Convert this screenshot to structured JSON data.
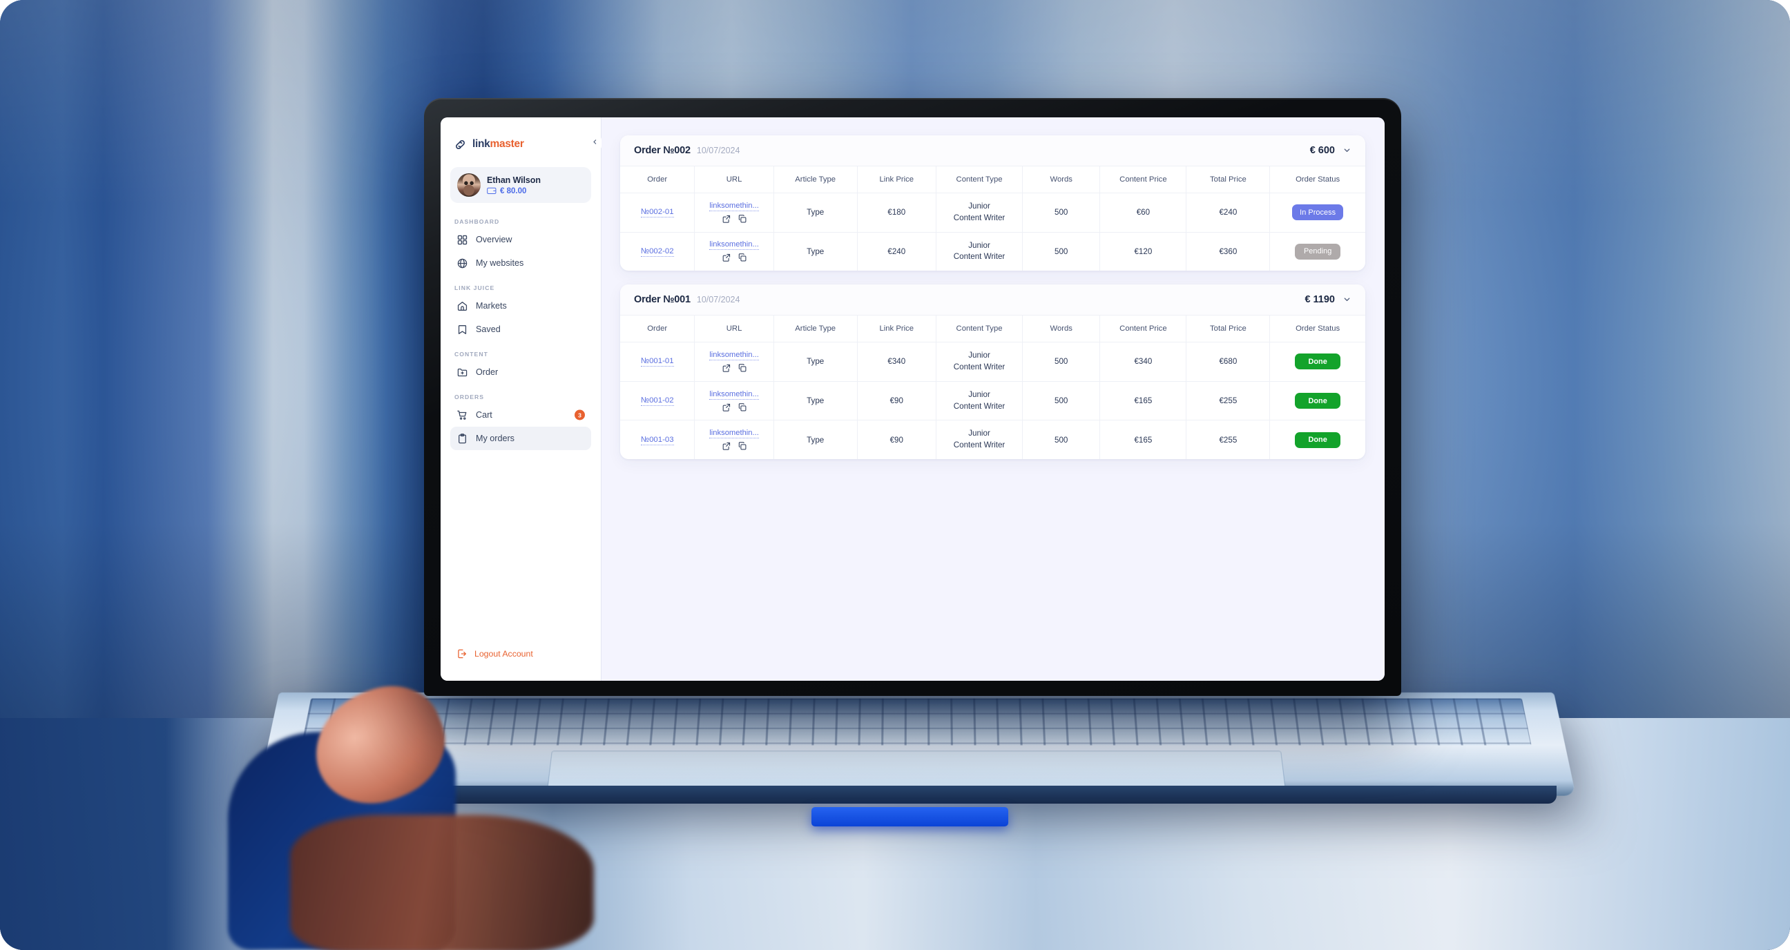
{
  "brand": {
    "name_part1": "link",
    "name_part2": "master",
    "logo_icon": "link-chain-icon"
  },
  "sidebar": {
    "collapse_icon": "chevron-left-icon",
    "user": {
      "name": "Ethan Wilson",
      "balance": "€ 80.00",
      "wallet_icon": "wallet-icon",
      "avatar_icon": "user-avatar"
    },
    "groups": [
      {
        "label": "DASHBOARD",
        "items": [
          {
            "label": "Overview",
            "icon": "grid-icon",
            "active": false,
            "badge": null
          },
          {
            "label": "My websites",
            "icon": "globe-icon",
            "active": false,
            "badge": null
          }
        ]
      },
      {
        "label": "LINK JUICE",
        "items": [
          {
            "label": "Markets",
            "icon": "store-icon",
            "active": false,
            "badge": null
          },
          {
            "label": "Saved",
            "icon": "bookmark-icon",
            "active": false,
            "badge": null
          }
        ]
      },
      {
        "label": "CONTENT",
        "items": [
          {
            "label": "Order",
            "icon": "folder-plus-icon",
            "active": false,
            "badge": null
          }
        ]
      },
      {
        "label": "ORDERS",
        "items": [
          {
            "label": "Cart",
            "icon": "cart-icon",
            "active": false,
            "badge": "3"
          },
          {
            "label": "My orders",
            "icon": "clipboard-icon",
            "active": true,
            "badge": null
          }
        ]
      }
    ],
    "logout": {
      "label": "Logout Account",
      "icon": "logout-icon"
    }
  },
  "colors": {
    "brand_orange": "#E8612F",
    "brand_navy": "#2C3D63",
    "link_blue": "#5B6FE0",
    "status_in_process": "#6C7AE8",
    "status_pending": "#AFAAAA",
    "status_done": "#13A32B",
    "page_bg": "#F4F4FE",
    "badge_orange": "#E8612F"
  },
  "main": {
    "columns": [
      "Order",
      "URL",
      "Article Type",
      "Link Price",
      "Content Type",
      "Words",
      "Content Price",
      "Total Price",
      "Order Status"
    ],
    "row_icons": {
      "external": "external-link-icon",
      "copy": "copy-icon"
    },
    "chevron_icon": "chevron-down-icon",
    "orders": [
      {
        "title": "Order №002",
        "date": "10/07/2024",
        "total": "€ 600",
        "rows": [
          {
            "order": "№002-01",
            "url": "linksomethin...",
            "article_type": "Type",
            "link_price": "€180",
            "content_type": "Junior Content Writer",
            "words": "500",
            "content_price": "€60",
            "total_price": "€240",
            "status": "In Process",
            "status_class": "inprocess"
          },
          {
            "order": "№002-02",
            "url": "linksomethin...",
            "article_type": "Type",
            "link_price": "€240",
            "content_type": "Junior Content Writer",
            "words": "500",
            "content_price": "€120",
            "total_price": "€360",
            "status": "Pending",
            "status_class": "pending"
          }
        ]
      },
      {
        "title": "Order №001",
        "date": "10/07/2024",
        "total": "€ 1190",
        "rows": [
          {
            "order": "№001-01",
            "url": "linksomethin...",
            "article_type": "Type",
            "link_price": "€340",
            "content_type": "Junior Content Writer",
            "words": "500",
            "content_price": "€340",
            "total_price": "€680",
            "status": "Done",
            "status_class": "done"
          },
          {
            "order": "№001-02",
            "url": "linksomethin...",
            "article_type": "Type",
            "link_price": "€90",
            "content_type": "Junior Content Writer",
            "words": "500",
            "content_price": "€165",
            "total_price": "€255",
            "status": "Done",
            "status_class": "done"
          },
          {
            "order": "№001-03",
            "url": "linksomethin...",
            "article_type": "Type",
            "link_price": "€90",
            "content_type": "Junior Content Writer",
            "words": "500",
            "content_price": "€165",
            "total_price": "€255",
            "status": "Done",
            "status_class": "done"
          }
        ]
      }
    ]
  }
}
